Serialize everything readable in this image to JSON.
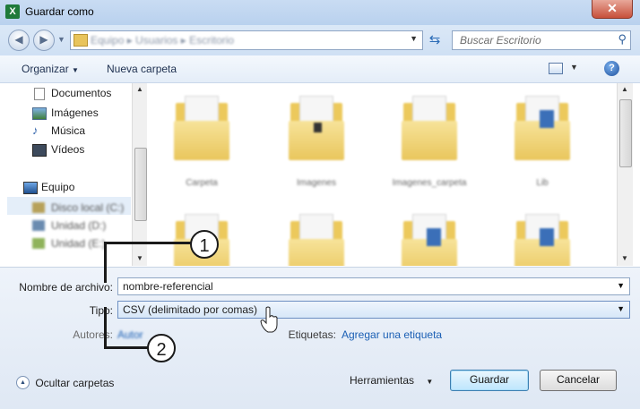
{
  "window": {
    "title": "Guardar como",
    "close_icon": "close-icon"
  },
  "address": {
    "back_icon": "back-arrow-icon",
    "forward_icon": "forward-arrow-icon",
    "path": "Equipo ▸ Usuarios ▸ Escritorio",
    "search_placeholder": "Buscar Escritorio"
  },
  "toolbar": {
    "organize": "Organizar",
    "new_folder": "Nueva carpeta",
    "help": "?"
  },
  "sidebar": {
    "items": [
      {
        "label": "Documentos",
        "icon": "documents-icon"
      },
      {
        "label": "Imágenes",
        "icon": "pictures-icon"
      },
      {
        "label": "Música",
        "icon": "music-icon"
      },
      {
        "label": "Vídeos",
        "icon": "videos-icon"
      },
      {
        "label": "Equipo",
        "icon": "computer-icon"
      }
    ],
    "blurred_drives": [
      "Disco local (C:)",
      "Unidad (D:)",
      "Unidad (E:)"
    ]
  },
  "files": [
    {
      "label": "Carpeta"
    },
    {
      "label": "Imagenes"
    },
    {
      "label": "Imagenes_carpeta"
    },
    {
      "label": "Lib"
    },
    {
      "label": ""
    },
    {
      "label": ""
    },
    {
      "label": ""
    },
    {
      "label": ""
    }
  ],
  "form": {
    "filename_label": "Nombre de archivo:",
    "filename_value": "nombre-referencial",
    "type_label": "Tipo:",
    "type_value": "CSV (delimitado por comas)",
    "authors_label": "Autores:",
    "authors_value": "Autor",
    "tags_label": "Etiquetas:",
    "tags_link": "Agregar una etiqueta"
  },
  "footer": {
    "hide_folders": "Ocultar carpetas",
    "tools": "Herramientas",
    "save": "Guardar",
    "cancel": "Cancelar"
  },
  "callouts": {
    "one": "1",
    "two": "2"
  }
}
